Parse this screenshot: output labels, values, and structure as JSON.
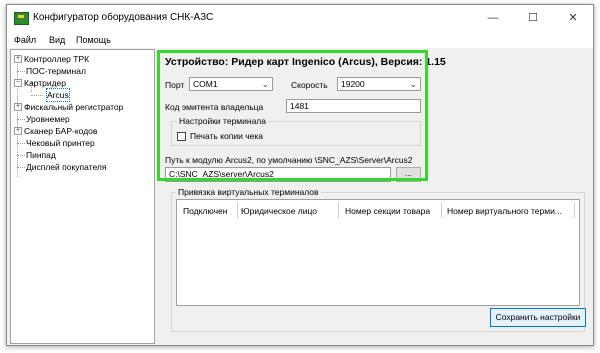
{
  "window": {
    "title": "Конфигуратор оборудования СНК-АЗС",
    "controls": {
      "minimize": "—",
      "maximize": "☐",
      "close": "✕"
    }
  },
  "menu": [
    "Файл",
    "Вид",
    "Помощь"
  ],
  "tree": [
    {
      "label": "Контроллер ТРК",
      "expander": "+"
    },
    {
      "label": "ПОС-терминал"
    },
    {
      "label": "Картридер",
      "expander": "−"
    },
    {
      "label": "Arcus",
      "selected": true
    },
    {
      "label": "Фискальный регистратор",
      "expander": "+"
    },
    {
      "label": "Уровнемер"
    },
    {
      "label": "Сканер БАР-кодов",
      "expander": "+"
    },
    {
      "label": "Чековый принтер"
    },
    {
      "label": "Пинпад"
    },
    {
      "label": "Дисплей покупателя"
    }
  ],
  "device": {
    "header": "Устройство: Ридер карт Ingenico (Arcus), Версия: 1.15",
    "port_label": "Порт",
    "port_value": "COM1",
    "speed_label": "Скорость",
    "speed_value": "19200",
    "issuer_label": "Код эмитента владельца",
    "issuer_value": "1481",
    "terminal_group": "Настройки терминала",
    "print_copy_label": "Печать копии чека",
    "print_copy_checked": false,
    "path_label": "Путь к модулю Arcus2, по умолчанию \\SNC_AZS\\Server\\Arcus2",
    "path_value": "C:\\SNC_AZS\\server\\Arcus2",
    "browse_label": "..."
  },
  "virtual_terminals": {
    "group_title": "Привязка виртуальных терминалов",
    "columns": [
      "Подключен",
      "Юридическое лицо",
      "Номер секции товара",
      "Номер виртуального терми..."
    ]
  },
  "save_button": "Сохранить настройки",
  "colors": {
    "highlight": "#37d62f",
    "selection": "#0078d7"
  }
}
